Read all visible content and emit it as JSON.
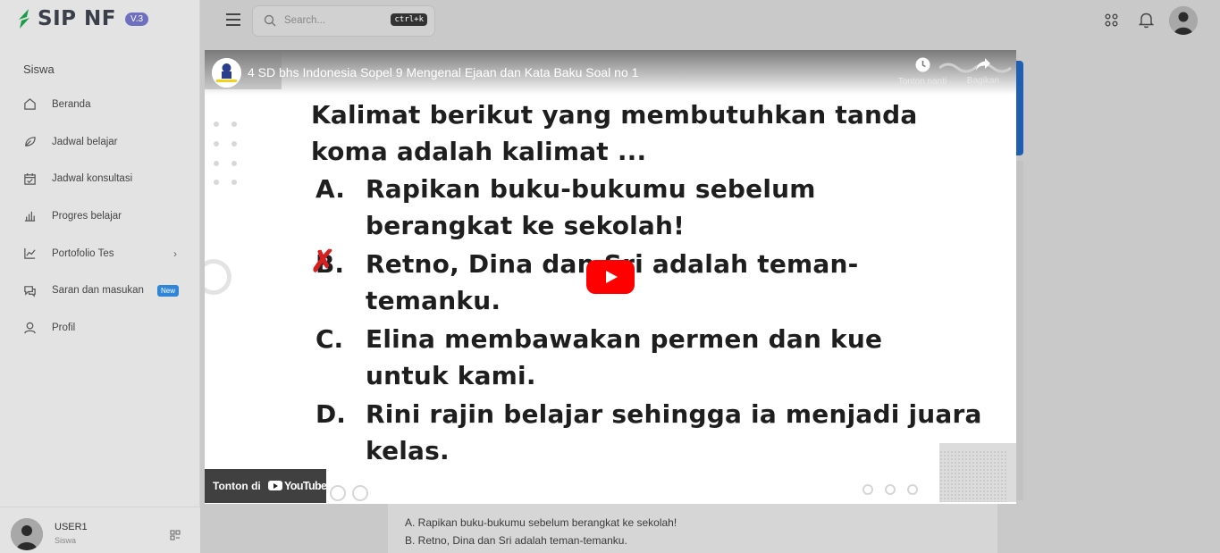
{
  "app": {
    "logo_text": "SIP NF",
    "version": "V.3",
    "colors": {
      "accent": "#6f6fbf",
      "brand_green": "#1a9c4a",
      "badge_blue": "#2f86d9",
      "play_red": "#ff0000"
    }
  },
  "sidebar": {
    "section_title": "Siswa",
    "items": [
      {
        "label": "Beranda",
        "icon": "home-icon"
      },
      {
        "label": "Jadwal belajar",
        "icon": "leaf-icon"
      },
      {
        "label": "Jadwal konsultasi",
        "icon": "calendar-check-icon"
      },
      {
        "label": "Progres belajar",
        "icon": "bar-chart-icon"
      },
      {
        "label": "Portofolio Tes",
        "icon": "trend-chart-icon",
        "chevron": "›"
      },
      {
        "label": "Saran dan masukan",
        "icon": "chat-icon",
        "badge": "New"
      },
      {
        "label": "Profil",
        "icon": "user-icon"
      }
    ],
    "user": {
      "name": "USER1",
      "role": "Siswa"
    }
  },
  "header": {
    "search_placeholder": "Search...",
    "search_shortcut": "ctrl+k"
  },
  "video": {
    "title": "4 SD bhs Indonesia Sopel 9 Mengenal Ejaan dan Kata Baku Soal no 1",
    "actions": {
      "watch_later": "Tonton nanti",
      "share": "Bagikan"
    },
    "watch_on": "Tonton di",
    "youtube": "YouTube",
    "question_lines": [
      "Kalimat berikut yang membutuhkan tanda",
      "koma adalah kalimat ..."
    ],
    "options": [
      {
        "letter": "A.",
        "lines": [
          "Rapikan buku-bukumu sebelum",
          "berangkat ke sekolah!"
        ]
      },
      {
        "letter": "B.",
        "lines": [
          "Retno, Dina dan Sri adalah teman-",
          "temanku."
        ]
      },
      {
        "letter": "C.",
        "lines": [
          "Elina membawakan permen dan kue",
          "untuk kami."
        ]
      },
      {
        "letter": "D.",
        "lines": [
          "Rini rajin belajar sehingga ia menjadi juara",
          "kelas."
        ]
      }
    ]
  },
  "content": {
    "answer_lines": [
      "A. Rapikan buku-bukumu sebelum berangkat ke sekolah!",
      "B. Retno, Dina dan Sri adalah teman-temanku."
    ]
  }
}
